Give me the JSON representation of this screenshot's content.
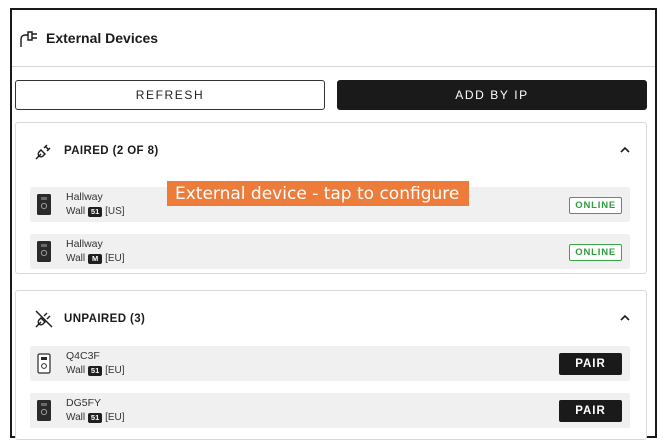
{
  "header": {
    "title": "External Devices",
    "icon": "plug-icon"
  },
  "actions": {
    "refresh_label": "REFRESH",
    "add_by_ip_label": "ADD BY IP"
  },
  "paired": {
    "label": "PAIRED (2 OF 8)",
    "icon": "plug-icon",
    "devices": [
      {
        "name": "Hallway",
        "model_prefix": "Wall",
        "chip": "51",
        "region": "[US]",
        "status": "ONLINE"
      },
      {
        "name": "Hallway",
        "model_prefix": "Wall",
        "chip": "M",
        "region": "[EU]",
        "status": "ONLINE"
      }
    ]
  },
  "unpaired": {
    "label": "UNPAIRED (3)",
    "icon": "unplugged-icon",
    "devices": [
      {
        "name": "Q4C3F",
        "model_prefix": "Wall",
        "chip": "51",
        "region": "[EU]",
        "action": "PAIR"
      },
      {
        "name": "DG5FY",
        "model_prefix": "Wall",
        "chip": "51",
        "region": "[EU]",
        "action": "PAIR"
      }
    ]
  },
  "overlay": {
    "tooltip": "External device - tap to configure"
  },
  "colors": {
    "online": "#2f9a3f",
    "tooltip": "#ed7c3b",
    "dark": "#1a1a1a"
  }
}
